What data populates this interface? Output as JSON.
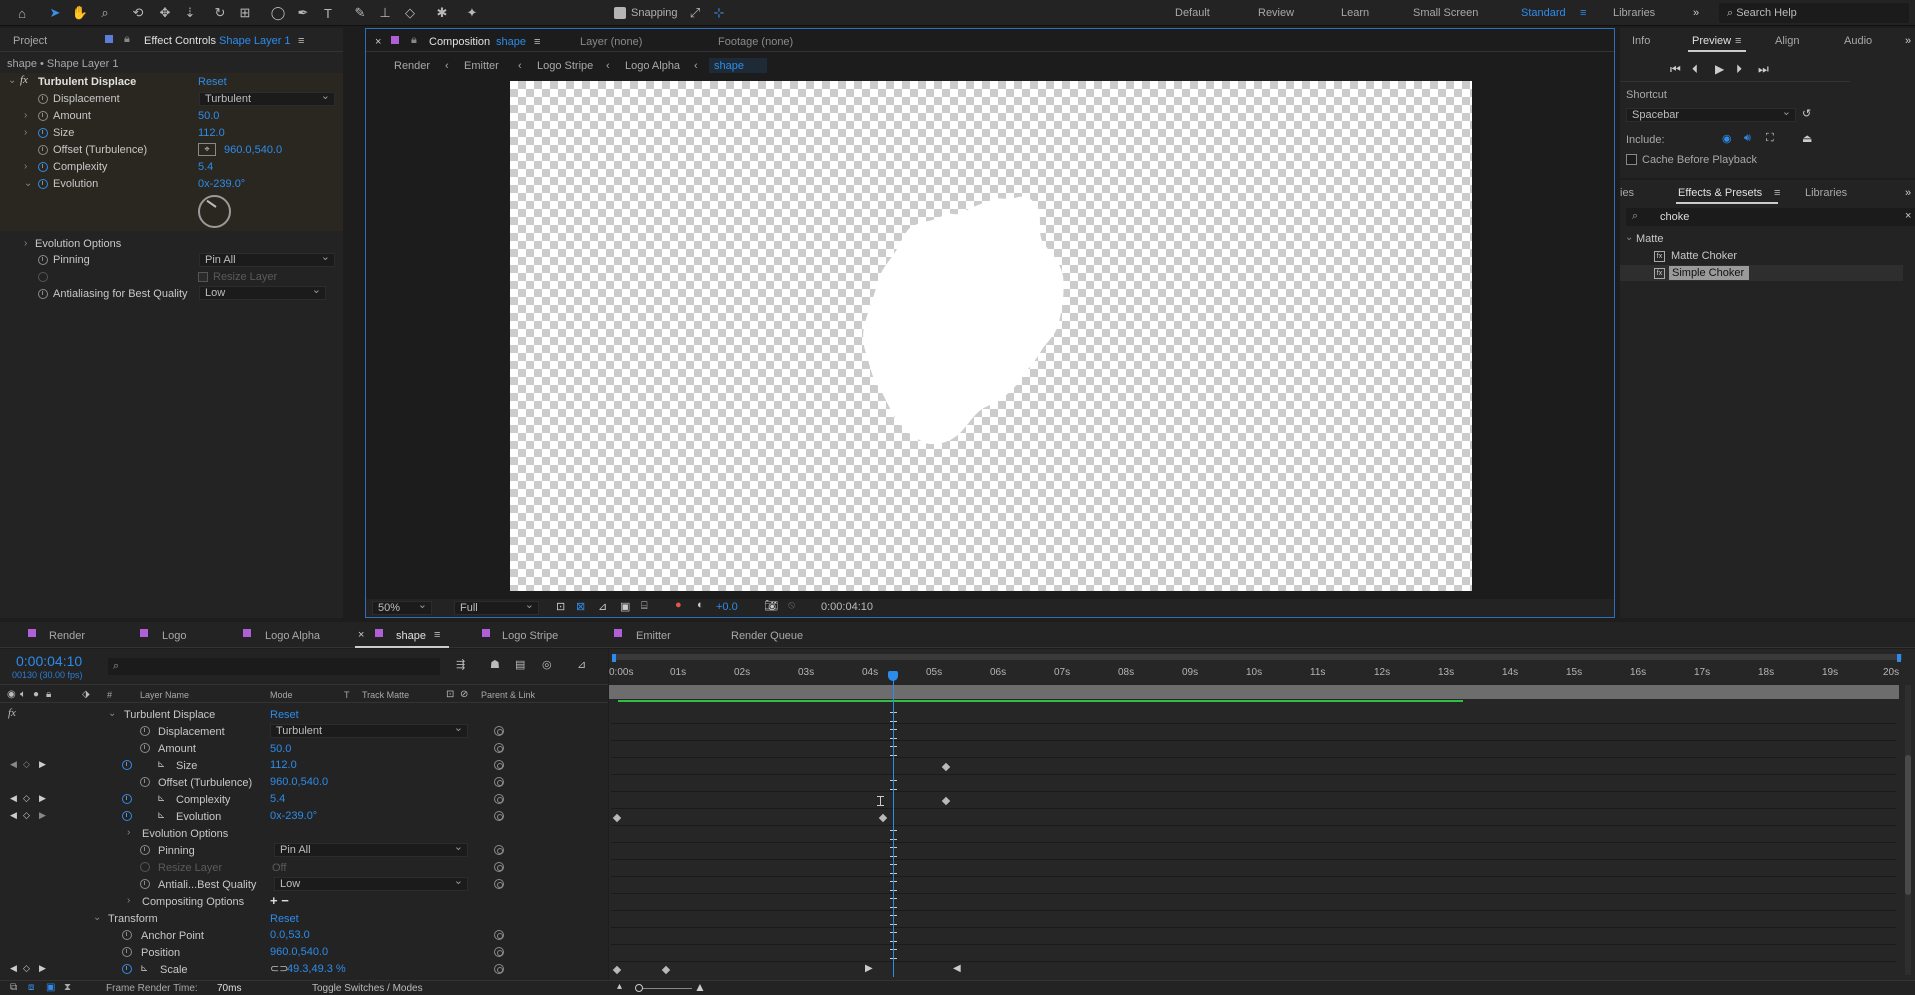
{
  "toolbar": {
    "snapping_label": "Snapping",
    "workspaces": [
      "Default",
      "Review",
      "Learn",
      "Small Screen",
      "Standard",
      "Libraries"
    ],
    "active_workspace": "Standard",
    "search_placeholder": "Search Help"
  },
  "left_panel": {
    "tab_project": "Project",
    "tab_effect_controls": "Effect Controls",
    "tab_effect_target": "Shape Layer 1",
    "layer_title": "shape • Shape Layer 1",
    "effect_name": "Turbulent Displace",
    "reset": "Reset",
    "props": [
      {
        "label": "Displacement",
        "value": "Turbulent"
      },
      {
        "label": "Amount",
        "value": "50.0"
      },
      {
        "label": "Size",
        "value": "112.0"
      },
      {
        "label": "Offset (Turbulence)",
        "value": "960.0,540.0"
      },
      {
        "label": "Complexity",
        "value": "5.4"
      },
      {
        "label": "Evolution",
        "value": "0x-239.0°"
      },
      {
        "label": "Evolution Options",
        "value": ""
      },
      {
        "label": "Pinning",
        "value": "Pin All"
      },
      {
        "label": "Resize Layer",
        "value": ""
      },
      {
        "label": "Antialiasing for Best Quality",
        "value": "Low"
      }
    ]
  },
  "comp_panel": {
    "tab_label": "Composition",
    "tab_comp": "shape",
    "layer_tab": "Layer (none)",
    "footage_tab": "Footage (none)",
    "breadcrumbs": [
      "Render",
      "Emitter",
      "Logo Stripe",
      "Logo Alpha",
      "shape"
    ],
    "zoom": "50%",
    "resolution": "Full",
    "exposure": "+0.0",
    "timecode": "0:00:04:10"
  },
  "right_panel": {
    "tabs_top": [
      "Info",
      "Preview",
      "Align",
      "Audio"
    ],
    "active_top": "Preview",
    "shortcut_label": "Shortcut",
    "shortcut_value": "Spacebar",
    "include_label": "Include:",
    "cache_label": "Cache Before Playback",
    "tabs_bottom": [
      "ies",
      "Effects & Presets",
      "Libraries"
    ],
    "active_bottom": "Effects & Presets",
    "search_value": "choke",
    "category": "Matte",
    "items": [
      "Matte Choker",
      "Simple Choker"
    ],
    "selected_item": "Simple Choker"
  },
  "timeline": {
    "tabs": [
      "Render",
      "Logo",
      "Logo Alpha",
      "shape",
      "Logo Stripe",
      "Emitter",
      "Render Queue"
    ],
    "active_tab": "shape",
    "timecode": "0:00:04:10",
    "frame_info": "00130 (30.00 fps)",
    "columns": {
      "layer_name": "Layer Name",
      "mode": "Mode",
      "t": "T",
      "track_matte": "Track Matte",
      "parent": "Parent & Link"
    },
    "effect_name": "Turbulent Displace",
    "reset": "Reset",
    "rows": [
      {
        "label": "Displacement",
        "value": "Turbulent"
      },
      {
        "label": "Amount",
        "value": "50.0"
      },
      {
        "label": "Size",
        "value": "112.0"
      },
      {
        "label": "Offset (Turbulence)",
        "value": "960.0,540.0"
      },
      {
        "label": "Complexity",
        "value": "5.4"
      },
      {
        "label": "Evolution",
        "value": "0x-239.0°"
      },
      {
        "label": "Evolution Options",
        "value": ""
      },
      {
        "label": "Pinning",
        "value": "Pin All"
      },
      {
        "label": "Resize Layer",
        "value": "Off"
      },
      {
        "label": "Antiali...Best Quality",
        "value": "Low"
      },
      {
        "label": "Compositing Options",
        "value": "+ −"
      },
      {
        "label": "Transform",
        "value": "Reset"
      },
      {
        "label": "Anchor Point",
        "value": "0.0,53.0"
      },
      {
        "label": "Position",
        "value": "960.0,540.0"
      },
      {
        "label": "Scale",
        "value": "49.3,49.3 %"
      }
    ],
    "ruler": [
      "0:00s",
      "01s",
      "02s",
      "03s",
      "04s",
      "05s",
      "06s",
      "07s",
      "08s",
      "09s",
      "10s",
      "11s",
      "12s",
      "13s",
      "14s",
      "15s",
      "16s",
      "17s",
      "18s",
      "19s",
      "20s"
    ],
    "footer_render_label": "Frame Render Time:",
    "footer_render_value": "70ms",
    "footer_toggle": "Toggle Switches / Modes"
  }
}
